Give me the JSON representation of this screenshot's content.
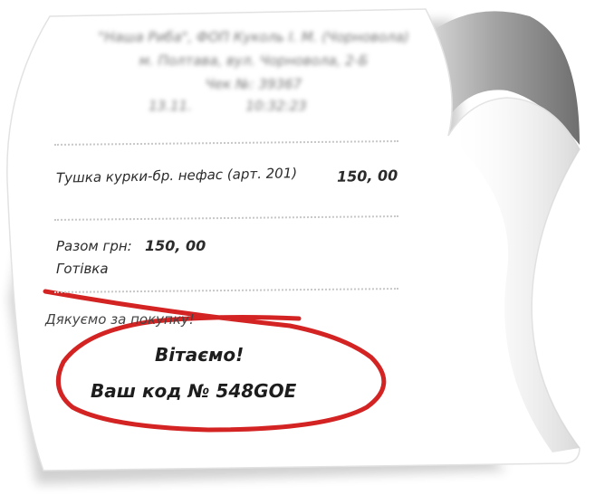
{
  "receipt": {
    "header": {
      "shop": "\"Наша Риба\", ФОП Куколь І. М. (Чорновола)",
      "address": "м. Полтава, вул. Чорновола, 2-Б",
      "check": "Чек №: 39367",
      "date": "13.11.",
      "time": "10:32:23"
    },
    "item": {
      "name": "Тушка курки-бр. нефас (арт. 201)",
      "price": "150, 00"
    },
    "total": {
      "label": "Разом грн:",
      "value": "150, 00",
      "payment": "Готівка"
    },
    "thanks": "Дякуємо за покупку!",
    "greeting": "Вітаємо!",
    "code_line": "Ваш код № 548GOE"
  },
  "colors": {
    "paper": "#ffffff",
    "ink": "#2b2b2b",
    "circle": "#d42323",
    "curl_shadow": "#9a9a9a"
  }
}
